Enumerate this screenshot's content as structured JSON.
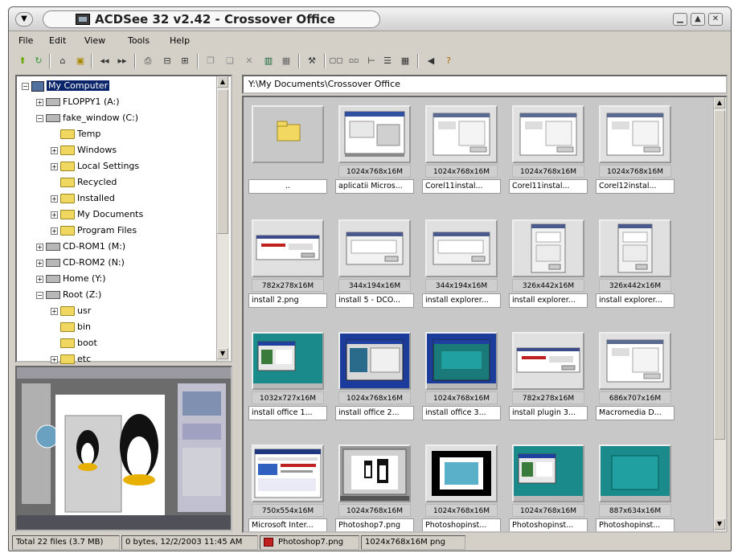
{
  "window": {
    "title": "ACDSee 32 v2.42 - Crossover Office"
  },
  "menu": [
    "File",
    "Edit",
    "View",
    "Tools",
    "Help"
  ],
  "tree": {
    "items": [
      {
        "label": "My Computer",
        "icon": "computer-icon",
        "depth": 0,
        "expander": "−",
        "selected": true
      },
      {
        "label": "FLOPPY1 (A:)",
        "icon": "drive-icon",
        "depth": 1,
        "expander": "+"
      },
      {
        "label": "fake_window (C:)",
        "icon": "drive-icon",
        "depth": 1,
        "expander": "−"
      },
      {
        "label": "Temp",
        "icon": "folder-icon",
        "depth": 2,
        "expander": ""
      },
      {
        "label": "Windows",
        "icon": "folder-icon",
        "depth": 2,
        "expander": "+"
      },
      {
        "label": "Local Settings",
        "icon": "folder-icon",
        "depth": 2,
        "expander": "+"
      },
      {
        "label": "Recycled",
        "icon": "folder-icon",
        "depth": 2,
        "expander": ""
      },
      {
        "label": "Installed",
        "icon": "folder-icon",
        "depth": 2,
        "expander": "+"
      },
      {
        "label": "My Documents",
        "icon": "folder-icon",
        "depth": 2,
        "expander": "+"
      },
      {
        "label": "Program Files",
        "icon": "folder-icon",
        "depth": 2,
        "expander": "+"
      },
      {
        "label": "CD-ROM1 (M:)",
        "icon": "drive-icon",
        "depth": 1,
        "expander": "+"
      },
      {
        "label": "CD-ROM2 (N:)",
        "icon": "drive-icon",
        "depth": 1,
        "expander": "+"
      },
      {
        "label": "Home (Y:)",
        "icon": "drive-icon",
        "depth": 1,
        "expander": "+"
      },
      {
        "label": "Root (Z:)",
        "icon": "drive-icon",
        "depth": 1,
        "expander": "−"
      },
      {
        "label": "usr",
        "icon": "folder-icon",
        "depth": 2,
        "expander": "+"
      },
      {
        "label": "bin",
        "icon": "folder-icon",
        "depth": 2,
        "expander": ""
      },
      {
        "label": "boot",
        "icon": "folder-icon",
        "depth": 2,
        "expander": ""
      },
      {
        "label": "etc",
        "icon": "folder-icon",
        "depth": 2,
        "expander": "+"
      }
    ]
  },
  "path": "Y:\\My Documents\\Crossover Office",
  "thumbnails": [
    {
      "dims": "",
      "name": "..",
      "kind": "folder"
    },
    {
      "dims": "1024x768x16M",
      "name": "aplicatii Micros...",
      "kind": "screen"
    },
    {
      "dims": "1024x768x16M",
      "name": "Corel11instal...",
      "kind": "dialog"
    },
    {
      "dims": "1024x768x16M",
      "name": "Corel11instal...",
      "kind": "dialog"
    },
    {
      "dims": "1024x768x16M",
      "name": "Corel12instal...",
      "kind": "dialog"
    },
    {
      "dims": "782x278x16M",
      "name": "install 2.png",
      "kind": "wide"
    },
    {
      "dims": "344x194x16M",
      "name": "install 5 - DCO...",
      "kind": "small"
    },
    {
      "dims": "344x194x16M",
      "name": "install explorer...",
      "kind": "small"
    },
    {
      "dims": "326x442x16M",
      "name": "install explorer...",
      "kind": "tall"
    },
    {
      "dims": "326x442x16M",
      "name": "install explorer...",
      "kind": "tall"
    },
    {
      "dims": "1032x727x16M",
      "name": "install office 1...",
      "kind": "teal"
    },
    {
      "dims": "1024x768x16M",
      "name": "install office 2...",
      "kind": "blue"
    },
    {
      "dims": "1024x768x16M",
      "name": "install office 3...",
      "kind": "bluegreen"
    },
    {
      "dims": "782x278x16M",
      "name": "install plugin 3...",
      "kind": "wide"
    },
    {
      "dims": "686x707x16M",
      "name": "Macromedia D...",
      "kind": "dialog"
    },
    {
      "dims": "750x554x16M",
      "name": "Microsoft Inter...",
      "kind": "browser"
    },
    {
      "dims": "1024x768x16M",
      "name": "Photoshop7.png",
      "kind": "photoshop"
    },
    {
      "dims": "1024x768x16M",
      "name": "Photoshopinst...",
      "kind": "black"
    },
    {
      "dims": "1024x768x16M",
      "name": "Photoshopinst...",
      "kind": "teal"
    },
    {
      "dims": "887x634x16M",
      "name": "Photoshopinst...",
      "kind": "tealplain"
    }
  ],
  "status": {
    "total": "Total 22 files (3.7 MB)",
    "info": "0 bytes, 12/2/2003 11:45 AM",
    "file": "Photoshop7.png",
    "dims": "1024x768x16M png"
  }
}
